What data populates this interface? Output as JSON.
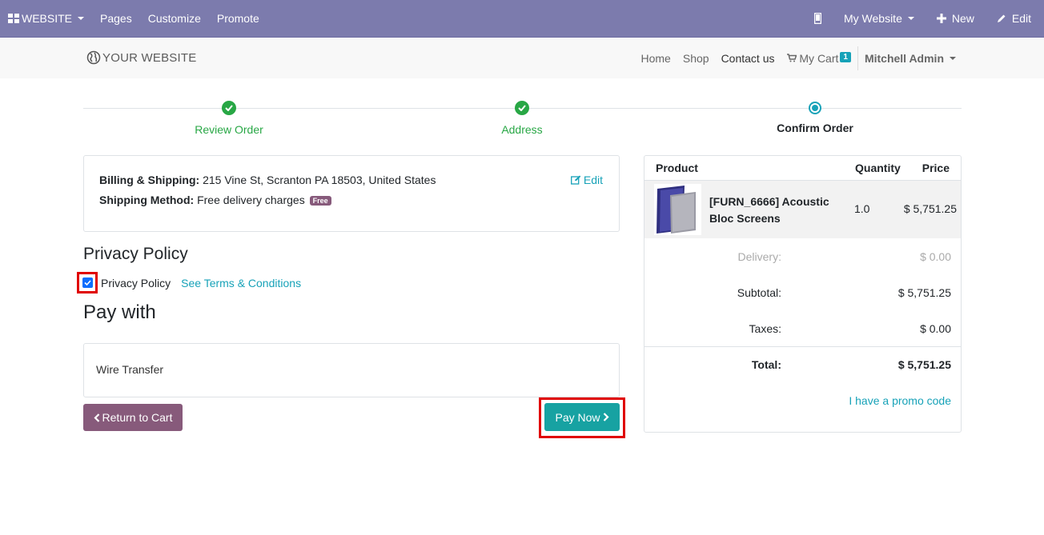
{
  "adminbar": {
    "website_menu": "WEBSITE",
    "pages": "Pages",
    "customize": "Customize",
    "promote": "Promote",
    "my_website": "My Website",
    "new": "New",
    "edit": "Edit"
  },
  "header": {
    "logo": "YOUR WEBSITE",
    "nav": {
      "home": "Home",
      "shop": "Shop",
      "contact": "Contact us",
      "cart": "My Cart",
      "cart_count": "1"
    },
    "user": "Mitchell Admin"
  },
  "wizard": {
    "steps": [
      {
        "label": "Review Order",
        "state": "done"
      },
      {
        "label": "Address",
        "state": "done"
      },
      {
        "label": "Confirm Order",
        "state": "current"
      }
    ]
  },
  "billing": {
    "billing_label": "Billing & Shipping:",
    "billing_value": " 215 Vine St, Scranton PA 18503, United States",
    "method_label": "Shipping Method:",
    "method_value": " Free delivery charges",
    "free_badge": "Free",
    "edit": "Edit"
  },
  "privacy": {
    "heading": "Privacy Policy",
    "checkbox_label": "Privacy Policy",
    "checked": true,
    "terms_link": "See Terms & Conditions"
  },
  "payment": {
    "heading": "Pay with",
    "method": "Wire Transfer",
    "return_button": "Return to Cart",
    "pay_button": "Pay Now"
  },
  "summary": {
    "col_product": "Product",
    "col_quantity": "Quantity",
    "col_price": "Price",
    "product_name": "[FURN_6666] Acoustic Bloc Screens",
    "product_qty": "1.0",
    "product_price": "$ 5,751.25",
    "delivery_label": "Delivery:",
    "delivery_value": "$ 0.00",
    "subtotal_label": "Subtotal:",
    "subtotal_value": "$ 5,751.25",
    "taxes_label": "Taxes:",
    "taxes_value": "$ 0.00",
    "total_label": "Total:",
    "total_value": "$ 5,751.25",
    "promo": "I have a promo code"
  },
  "colors": {
    "admin_bar": "#7c7bad",
    "success": "#28a745",
    "accent": "#17a2b8",
    "brand": "#875a7b",
    "highlight": "#e00000"
  }
}
